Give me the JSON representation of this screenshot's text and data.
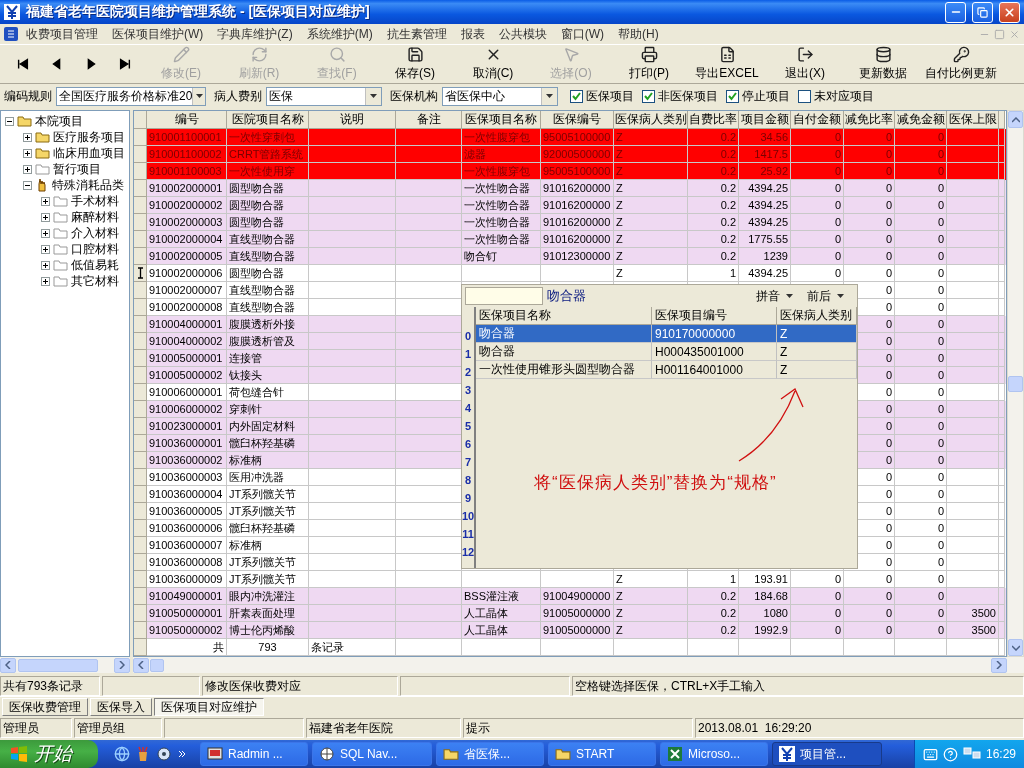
{
  "window": {
    "title": "福建省老年医院项目维护管理系统 - [医保项目对应维护]"
  },
  "menu": [
    "收费项目管理",
    "医保项目维护(W)",
    "字典库维护(Z)",
    "系统维护(M)",
    "抗生素管理",
    "报表",
    "公共模块",
    "窗口(W)",
    "帮助(H)"
  ],
  "toolbar": {
    "nav": [
      {
        "kind": "first"
      },
      {
        "kind": "prev"
      },
      {
        "kind": "next"
      },
      {
        "kind": "last"
      }
    ],
    "buttons": [
      {
        "kind": "edit",
        "label": "修改(E)",
        "disabled": true
      },
      {
        "kind": "refresh",
        "label": "刷新(R)",
        "disabled": true
      },
      {
        "kind": "find",
        "label": "查找(F)",
        "disabled": true
      },
      {
        "kind": "save",
        "label": "保存(S)",
        "disabled": false
      },
      {
        "kind": "cancel",
        "label": "取消(C)",
        "disabled": false
      },
      {
        "kind": "select",
        "label": "选择(O)",
        "disabled": true
      },
      {
        "kind": "print",
        "label": "打印(P)",
        "disabled": false
      },
      {
        "kind": "export",
        "label": "导出EXCEL",
        "disabled": false
      },
      {
        "kind": "exit",
        "label": "退出(X)",
        "disabled": false
      },
      {
        "kind": "update",
        "label": "更新数据",
        "disabled": false
      },
      {
        "kind": "ratio",
        "label": "自付比例更新",
        "disabled": false
      }
    ]
  },
  "filters": {
    "selects": [
      {
        "label": "编码规则",
        "value": "全国医疗服务价格标准20"
      },
      {
        "label": "病人费别",
        "value": "医保"
      },
      {
        "label": "医保机构",
        "value": "省医保中心"
      }
    ],
    "checkboxes": [
      {
        "label": "医保项目",
        "checked": true
      },
      {
        "label": "非医保项目",
        "checked": true
      },
      {
        "label": "停止项目",
        "checked": true
      },
      {
        "label": "未对应项目",
        "checked": false
      }
    ]
  },
  "tree": [
    {
      "label": "本院项目",
      "kind": "folder",
      "expanded": true,
      "children": [
        {
          "label": "医疗服务项目",
          "kind": "folder",
          "expanded": false
        },
        {
          "label": "临床用血项目",
          "kind": "folder",
          "expanded": false
        },
        {
          "label": "暂行项目",
          "kind": "empty",
          "expanded": false
        },
        {
          "label": "特殊消耗品类",
          "kind": "hand",
          "expanded": true,
          "children": [
            {
              "label": "手术材料",
              "kind": "empty",
              "expanded": false
            },
            {
              "label": "麻醉材料",
              "kind": "empty",
              "expanded": false
            },
            {
              "label": "介入材料",
              "kind": "empty",
              "expanded": false
            },
            {
              "label": "口腔材料",
              "kind": "empty",
              "expanded": false
            },
            {
              "label": "低值易耗",
              "kind": "empty",
              "expanded": false
            },
            {
              "label": "其它材料",
              "kind": "empty",
              "expanded": false
            }
          ]
        }
      ]
    }
  ],
  "table": {
    "columns": [
      "编号",
      "医院项目名称",
      "说明",
      "备注",
      "医保项目名称",
      "医保编号",
      "医保病人类别",
      "自费比率",
      "项目金额",
      "自付金额",
      "减免比率",
      "减免金额",
      "医保上限"
    ],
    "rows": [
      {
        "kind": "error",
        "selected": false,
        "code": "910001100001",
        "name": "一次性穿刺包",
        "ins_name": "一次性腹穿包",
        "ins_code": "95005100000",
        "category": "Z",
        "self_ratio": "0.2",
        "amount": "34.56",
        "self_pay": "0",
        "reduce_rate": "0",
        "reduce_amount": "0"
      },
      {
        "kind": "error",
        "selected": false,
        "code": "910001100002",
        "name": "CRRT管路系统",
        "ins_name": "滤器",
        "ins_code": "92000500000",
        "category": "Z",
        "self_ratio": "0.2",
        "amount": "1417.5",
        "self_pay": "0",
        "reduce_rate": "0",
        "reduce_amount": "0"
      },
      {
        "kind": "error",
        "selected": false,
        "code": "910001100003",
        "name": "一次性使用穿",
        "ins_name": "一次性腹穿包",
        "ins_code": "95005100000",
        "category": "Z",
        "self_ratio": "0.2",
        "amount": "25.92",
        "self_pay": "0",
        "reduce_rate": "0",
        "reduce_amount": "0"
      },
      {
        "kind": "mapped",
        "selected": false,
        "code": "910002000001",
        "name": "圆型吻合器",
        "ins_name": "一次性吻合器",
        "ins_code": "91016200000",
        "category": "Z",
        "self_ratio": "0.2",
        "amount": "4394.25",
        "self_pay": "0",
        "reduce_rate": "0",
        "reduce_amount": "0"
      },
      {
        "kind": "mapped",
        "selected": false,
        "code": "910002000002",
        "name": "圆型吻合器",
        "ins_name": "一次性吻合器",
        "ins_code": "91016200000",
        "category": "Z",
        "self_ratio": "0.2",
        "amount": "4394.25",
        "self_pay": "0",
        "reduce_rate": "0",
        "reduce_amount": "0"
      },
      {
        "kind": "mapped",
        "selected": false,
        "code": "910002000003",
        "name": "圆型吻合器",
        "ins_name": "一次性吻合器",
        "ins_code": "91016200000",
        "category": "Z",
        "self_ratio": "0.2",
        "amount": "4394.25",
        "self_pay": "0",
        "reduce_rate": "0",
        "reduce_amount": "0"
      },
      {
        "kind": "mapped",
        "selected": false,
        "code": "910002000004",
        "name": "直线型吻合器",
        "ins_name": "一次性吻合器",
        "ins_code": "91016200000",
        "category": "Z",
        "self_ratio": "0.2",
        "amount": "1775.55",
        "self_pay": "0",
        "reduce_rate": "0",
        "reduce_amount": "0"
      },
      {
        "kind": "mapped",
        "selected": false,
        "code": "910002000005",
        "name": "直线型吻合器",
        "ins_name": "吻合钉",
        "ins_code": "91012300000",
        "category": "Z",
        "self_ratio": "0.2",
        "amount": "1239",
        "self_pay": "0",
        "reduce_rate": "0",
        "reduce_amount": "0"
      },
      {
        "kind": "plain",
        "selected": true,
        "code": "910002000006",
        "name": "圆型吻合器",
        "category": "Z",
        "self_ratio": "1",
        "amount": "4394.25",
        "self_pay": "0",
        "reduce_rate": "0",
        "reduce_amount": "0"
      },
      {
        "kind": "plain",
        "selected": false,
        "code": "910002000007",
        "name": "直线型吻合器",
        "reduce_rate": "0",
        "reduce_amount": "0"
      },
      {
        "kind": "plain",
        "selected": false,
        "code": "910002000008",
        "name": "直线型吻合器",
        "reduce_rate": "0",
        "reduce_amount": "0"
      },
      {
        "kind": "mapped",
        "selected": false,
        "code": "910004000001",
        "name": "腹膜透析外接",
        "reduce_rate": "0",
        "reduce_amount": "0"
      },
      {
        "kind": "mapped",
        "selected": false,
        "code": "910004000002",
        "name": "腹膜透析管及",
        "reduce_rate": "0",
        "reduce_amount": "0"
      },
      {
        "kind": "mapped",
        "selected": false,
        "code": "910005000001",
        "name": "连接管",
        "reduce_rate": "0",
        "reduce_amount": "0"
      },
      {
        "kind": "mapped",
        "selected": false,
        "code": "910005000002",
        "name": "钛接头",
        "reduce_rate": "0",
        "reduce_amount": "0"
      },
      {
        "kind": "plain",
        "selected": false,
        "code": "910006000001",
        "name": "荷包缝合针",
        "reduce_rate": "0",
        "reduce_amount": "0"
      },
      {
        "kind": "mapped",
        "selected": false,
        "code": "910006000002",
        "name": "穿刺针",
        "reduce_rate": "0",
        "reduce_amount": "0"
      },
      {
        "kind": "mapped",
        "selected": false,
        "code": "910023000001",
        "name": "内外固定材料",
        "reduce_rate": "0",
        "reduce_amount": "0"
      },
      {
        "kind": "mapped",
        "selected": false,
        "code": "910036000001",
        "name": "髋臼杯羟基磷",
        "reduce_rate": "0",
        "reduce_amount": "0"
      },
      {
        "kind": "mapped",
        "selected": false,
        "code": "910036000002",
        "name": "标准柄",
        "reduce_rate": "0",
        "reduce_amount": "0"
      },
      {
        "kind": "plain",
        "selected": false,
        "code": "910036000003",
        "name": "医用冲洗器",
        "reduce_rate": "0",
        "reduce_amount": "0"
      },
      {
        "kind": "plain",
        "selected": false,
        "code": "910036000004",
        "name": "JT系列髋关节",
        "reduce_rate": "0",
        "reduce_amount": "0"
      },
      {
        "kind": "plain",
        "selected": false,
        "code": "910036000005",
        "name": "JT系列髋关节",
        "reduce_rate": "0",
        "reduce_amount": "0"
      },
      {
        "kind": "plain",
        "selected": false,
        "code": "910036000006",
        "name": "髋臼杯羟基磷",
        "reduce_rate": "0",
        "reduce_amount": "0"
      },
      {
        "kind": "plain",
        "selected": false,
        "code": "910036000007",
        "name": "标准柄",
        "reduce_rate": "0",
        "reduce_amount": "0"
      },
      {
        "kind": "plain",
        "selected": false,
        "code": "910036000008",
        "name": "JT系列髋关节",
        "reduce_rate": "0",
        "reduce_amount": "0"
      },
      {
        "kind": "plain",
        "selected": false,
        "code": "910036000009",
        "name": "JT系列髋关节",
        "category": "Z",
        "self_ratio": "1",
        "amount": "193.91",
        "self_pay": "0",
        "reduce_rate": "0",
        "reduce_amount": "0"
      },
      {
        "kind": "mapped",
        "selected": false,
        "code": "910049000001",
        "name": "眼内冲洗灌注",
        "ins_name": "BSS灌注液",
        "ins_code": "91004900000",
        "category": "Z",
        "self_ratio": "0.2",
        "amount": "184.68",
        "self_pay": "0",
        "reduce_rate": "0",
        "reduce_amount": "0"
      },
      {
        "kind": "mapped",
        "selected": false,
        "code": "910050000001",
        "name": "肝素表面处理",
        "ins_name": "人工晶体",
        "ins_code": "91005000000",
        "category": "Z",
        "self_ratio": "0.2",
        "amount": "1080",
        "self_pay": "0",
        "reduce_rate": "0",
        "reduce_amount": "0",
        "ins_limit": "3500"
      },
      {
        "kind": "mapped",
        "selected": false,
        "code": "910050000002",
        "name": "博士伦丙烯酸",
        "ins_name": "人工晶体",
        "ins_code": "91005000000",
        "category": "Z",
        "self_ratio": "0.2",
        "amount": "1992.9",
        "self_pay": "0",
        "reduce_rate": "0",
        "reduce_amount": "0",
        "ins_limit": "3500"
      }
    ],
    "footer": [
      "共",
      "793",
      "条记录"
    ]
  },
  "lookup": {
    "query": "吻合器",
    "sort_options": [
      "拼音",
      "前后"
    ],
    "columns": [
      "医保项目名称",
      "医保项目编号",
      "医保病人类别"
    ],
    "row_numbers": [
      "0",
      "1",
      "2",
      "3",
      "4",
      "5",
      "6",
      "7",
      "8",
      "9",
      "10",
      "11",
      "12"
    ],
    "rows": [
      {
        "selected": true,
        "name": "吻合器",
        "code": "910170000000",
        "category": "Z"
      },
      {
        "selected": false,
        "name": "吻合器",
        "code": "H000435001000",
        "category": "Z"
      },
      {
        "selected": false,
        "name": "一次性使用锥形头圆型吻合器",
        "code": "H001164001000",
        "category": "Z"
      }
    ]
  },
  "annotation": {
    "text": "将“医保病人类别”替换为“规格”"
  },
  "status_bar": [
    "共有793条记录",
    "修改医保收费对应",
    "空格键选择医保，CTRL+X手工输入"
  ],
  "tabs": [
    {
      "label": "医保收费管理",
      "selected": false
    },
    {
      "label": "医保导入",
      "selected": false
    },
    {
      "label": "医保项目对应维护",
      "selected": true
    }
  ],
  "info_bar": {
    "user": "管理员",
    "group": "管理员组",
    "hospital": "福建省老年医院",
    "hint": "提示",
    "datetime": "2013.08.01  16:29:20"
  },
  "taskbar": {
    "start": "开始",
    "tasks": [
      {
        "kind": "radmin",
        "label": "Radmin ...",
        "active": false
      },
      {
        "kind": "sql",
        "label": "SQL Nav...",
        "active": false
      },
      {
        "kind": "folder",
        "label": "省医保...",
        "active": false
      },
      {
        "kind": "folder",
        "label": "START",
        "active": false
      },
      {
        "kind": "excel",
        "label": "Microso...",
        "active": false
      },
      {
        "kind": "app",
        "label": "项目管...",
        "active": true
      }
    ],
    "clock": "16:29"
  }
}
